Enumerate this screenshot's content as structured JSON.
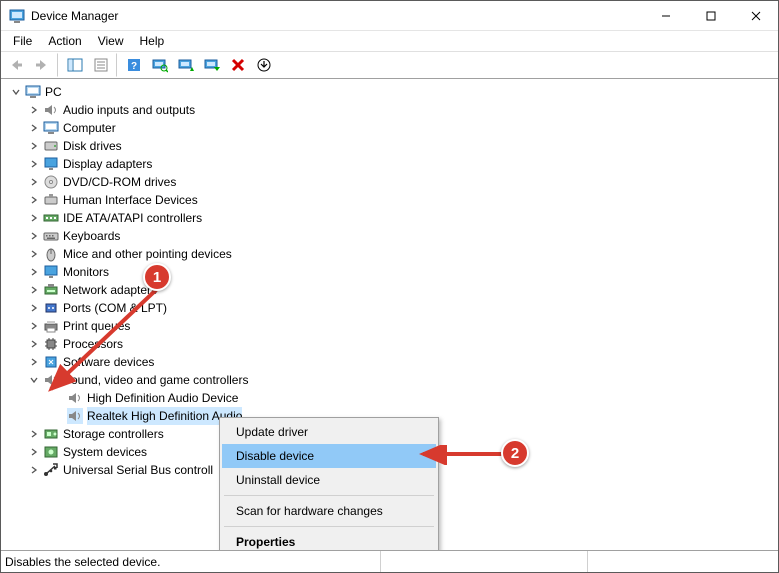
{
  "window": {
    "title": "Device Manager"
  },
  "menu": {
    "file": "File",
    "action": "Action",
    "view": "View",
    "help": "Help"
  },
  "tree": {
    "root": "PC",
    "items": [
      {
        "label": "Audio inputs and outputs"
      },
      {
        "label": "Computer"
      },
      {
        "label": "Disk drives"
      },
      {
        "label": "Display adapters"
      },
      {
        "label": "DVD/CD-ROM drives"
      },
      {
        "label": "Human Interface Devices"
      },
      {
        "label": "IDE ATA/ATAPI controllers"
      },
      {
        "label": "Keyboards"
      },
      {
        "label": "Mice and other pointing devices"
      },
      {
        "label": "Monitors"
      },
      {
        "label": "Network adapters"
      },
      {
        "label": "Ports (COM & LPT)"
      },
      {
        "label": "Print queues"
      },
      {
        "label": "Processors"
      },
      {
        "label": "Software devices"
      }
    ],
    "sound": {
      "label": "Sound, video and game controllers",
      "children": [
        {
          "label": "High Definition Audio Device"
        },
        {
          "label": "Realtek High Definition Audio"
        }
      ]
    },
    "after": [
      {
        "label": "Storage controllers"
      },
      {
        "label": "System devices"
      },
      {
        "label": "Universal Serial Bus controll"
      }
    ]
  },
  "context_menu": {
    "update": "Update driver",
    "disable": "Disable device",
    "uninstall": "Uninstall device",
    "scan": "Scan for hardware changes",
    "props": "Properties"
  },
  "status": {
    "text": "Disables the selected device."
  },
  "annotations": {
    "badge1": "1",
    "badge2": "2"
  }
}
